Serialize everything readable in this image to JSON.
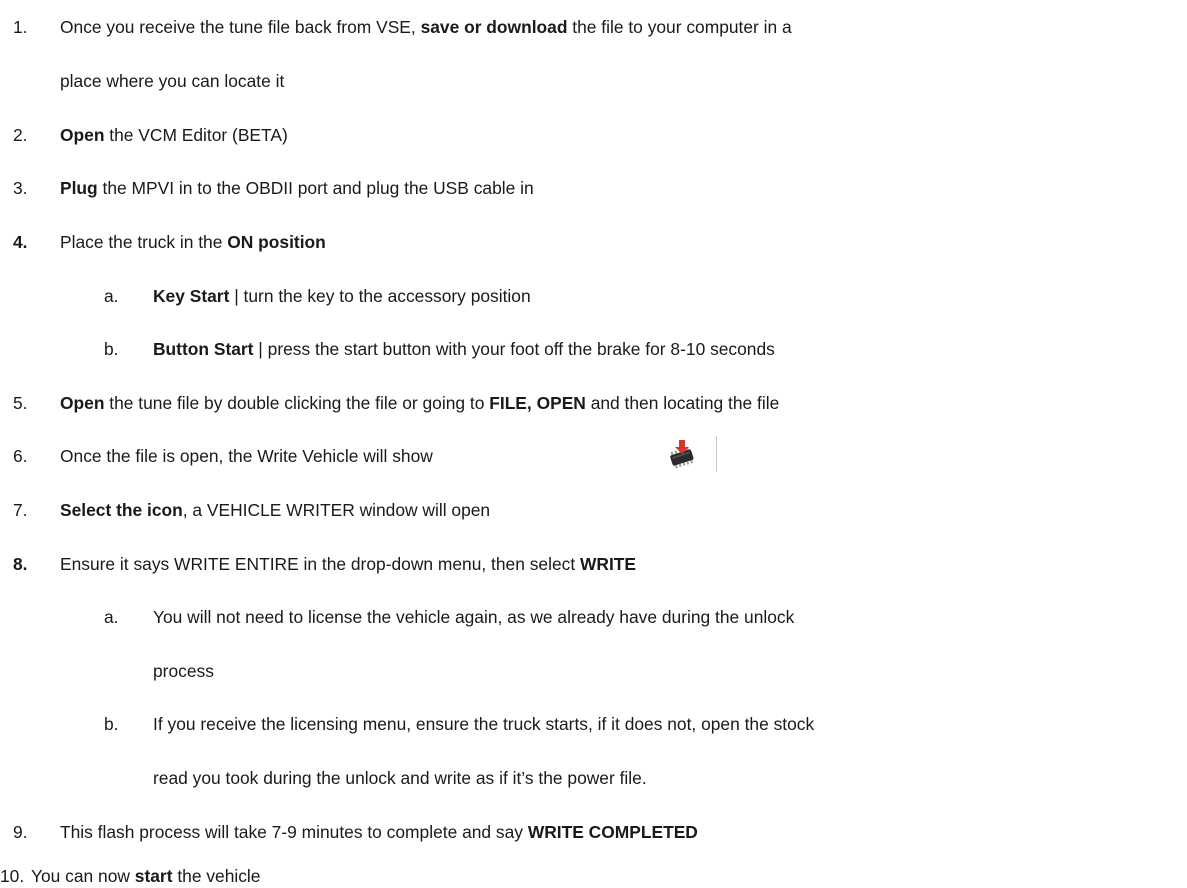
{
  "steps": [
    {
      "num": "1.",
      "line1": [
        {
          "t": "Once you receive the tune file back from VSE, "
        },
        {
          "t": "save or download",
          "b": true
        },
        {
          "t": " the file to your computer in a"
        }
      ],
      "line2": "place where you can locate it"
    },
    {
      "num": "2.",
      "parts": [
        {
          "t": "Open",
          "b": true
        },
        {
          "t": " the VCM Editor (BETA)"
        }
      ]
    },
    {
      "num": "3.",
      "parts": [
        {
          "t": "Plug",
          "b": true
        },
        {
          "t": " the MPVI in to the OBDII port and plug the USB cable in"
        }
      ]
    },
    {
      "num": "4.",
      "parts": [
        {
          "t": "Place the truck in the "
        },
        {
          "t": "ON position",
          "b": true
        }
      ],
      "sub": [
        {
          "letter": "a.",
          "parts": [
            {
              "t": "Key Start",
              "b": true
            },
            {
              "t": " | turn the key to the accessory position"
            }
          ]
        },
        {
          "letter": "b.",
          "parts": [
            {
              "t": "Button Start",
              "b": true
            },
            {
              "t": " | press the start button with your foot off the brake for 8-10 seconds"
            }
          ]
        }
      ]
    },
    {
      "num": "5.",
      "parts": [
        {
          "t": "Open",
          "b": true
        },
        {
          "t": " the tune file by double clicking the file or going to "
        },
        {
          "t": "FILE, OPEN",
          "b": true
        },
        {
          "t": " and then locating the file"
        }
      ]
    },
    {
      "num": "6.",
      "parts": [
        {
          "t": "Once the file is open, the Write Vehicle will show"
        }
      ],
      "icon": "write-vehicle-chip-icon"
    },
    {
      "num": "7.",
      "parts": [
        {
          "t": "Select the icon",
          "b": true
        },
        {
          "t": ", a VEHICLE WRITER window will open"
        }
      ]
    },
    {
      "num": "8.",
      "parts": [
        {
          "t": "Ensure it says WRITE ENTIRE in the drop-down menu, then select "
        },
        {
          "t": "WRITE",
          "b": true
        }
      ],
      "sub": [
        {
          "letter": "a.",
          "line1": "You will not need to license the vehicle again, as we already have during the unlock",
          "line2": "process"
        },
        {
          "letter": "b.",
          "line1": "If you receive the licensing menu, ensure the truck starts, if it does not, open the stock",
          "line2": "read you took during the unlock and write as if it’s the power file."
        }
      ]
    },
    {
      "num": "9.",
      "parts": [
        {
          "t": "This flash process will take 7-9 minutes to complete and say "
        },
        {
          "t": "WRITE COMPLETED",
          "b": true
        }
      ]
    },
    {
      "num": "10.",
      "parts": [
        {
          "t": "You can now "
        },
        {
          "t": "start",
          "b": true
        },
        {
          "t": " the vehicle"
        }
      ]
    }
  ],
  "colors": {
    "text": "#1a1a1a",
    "icon_arrow": "#d9342b",
    "icon_chip": "#2b2b2b"
  }
}
